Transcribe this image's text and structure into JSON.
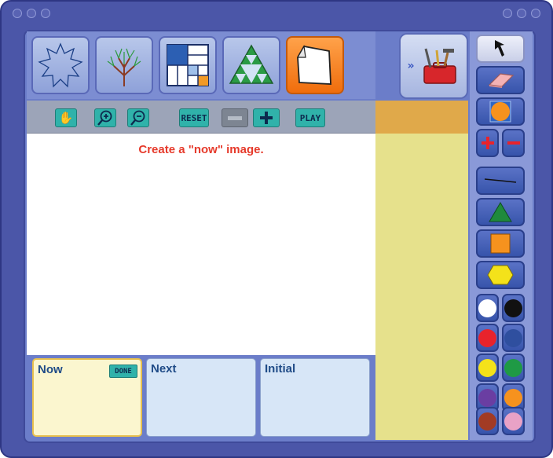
{
  "colors": {
    "frame": "#4b56a8",
    "accent_orange": "#f06d0c",
    "teal_button": "#30b2aa",
    "prompt_red": "#e63a2b",
    "side_column": "#e6e18c"
  },
  "top_thumbnails": [
    {
      "name": "snowflake-fractal",
      "icon": "snowflake-outline-icon"
    },
    {
      "name": "tree-fractal",
      "icon": "tree-branches-icon"
    },
    {
      "name": "square-subdivision",
      "icon": "square-grid-icon"
    },
    {
      "name": "sierpinski-triangle",
      "icon": "triangle-fractal-icon"
    },
    {
      "name": "custom-page",
      "icon": "blank-page-icon",
      "active": true
    }
  ],
  "toolbox": {
    "icon": "toolbox-icon",
    "expand_icon": "double-chevron-icon"
  },
  "controls": {
    "pan_icon": "hand-icon",
    "zoom_in_icon": "zoom-in-icon",
    "zoom_out_icon": "zoom-out-icon",
    "reset_label": "RESET",
    "minus_icon": "minus-icon",
    "plus_icon": "plus-icon",
    "play_label": "PLAY"
  },
  "canvas": {
    "prompt": "Create a \"now\" image."
  },
  "frames": [
    {
      "label": "Now",
      "done_label": "DONE"
    },
    {
      "label": "Next"
    },
    {
      "label": "Initial"
    }
  ],
  "tools": [
    "arrow-select-icon",
    "eraser-icon",
    "circle-in-square-icon",
    "line-icon",
    "triangle-icon",
    "square-icon",
    "hexagon-icon"
  ],
  "palette": [
    {
      "name": "white",
      "hex": "#ffffff"
    },
    {
      "name": "black",
      "hex": "#111111"
    },
    {
      "name": "red",
      "hex": "#e8232c"
    },
    {
      "name": "dark-blue",
      "hex": "#2f4f9f"
    },
    {
      "name": "yellow",
      "hex": "#f4e21a"
    },
    {
      "name": "green",
      "hex": "#1f9a45"
    },
    {
      "name": "purple",
      "hex": "#6a3ea2"
    },
    {
      "name": "orange",
      "hex": "#f6921e"
    },
    {
      "name": "brown",
      "hex": "#a23b24"
    },
    {
      "name": "pink",
      "hex": "#e9a2c6"
    }
  ]
}
